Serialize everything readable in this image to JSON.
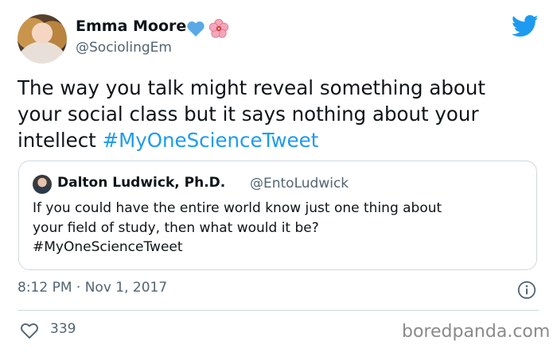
{
  "tweet": {
    "author": {
      "name": "Emma Moore",
      "handle": "@SociolingEm"
    },
    "text_parts": {
      "plain": "The way you talk might reveal something about your social class but it says nothing about your intellect ",
      "hashtag": "#MyOneScienceTweet"
    },
    "quoted": {
      "name": "Dalton Ludwick, Ph.D.",
      "handle": "@EntoLudwick",
      "text_line1": "If you could have the entire world know just one thing about",
      "text_line2": "your field of study, then what would it be?",
      "hashtag": "#MyOneScienceTweet"
    },
    "timestamp": "8:12 PM · Nov 1, 2017",
    "likes": "339"
  },
  "watermark": "boredpanda.com",
  "icons": {
    "heart": "blue-heart-icon",
    "flower": "hibiscus-icon",
    "brand": "twitter-bird-icon",
    "info": "info-icon",
    "like": "like-heart-icon"
  },
  "colors": {
    "accent": "#1d9bf0",
    "text": "#0f1419",
    "muted": "#536471",
    "border": "#cfd9de",
    "blue_heart": "#5aa9e6",
    "flower": "#f4a7b9"
  }
}
